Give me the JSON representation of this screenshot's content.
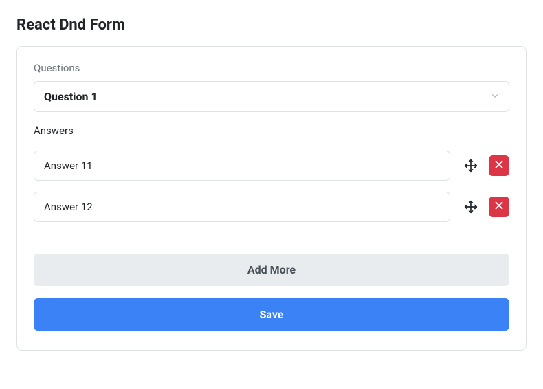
{
  "title": "React Dnd Form",
  "questions": {
    "label": "Questions",
    "selected": "Question 1"
  },
  "answers": {
    "label": "Answers",
    "items": [
      {
        "value": "Answer 11"
      },
      {
        "value": "Answer 12"
      }
    ]
  },
  "buttons": {
    "add_more": "Add More",
    "save": "Save"
  },
  "colors": {
    "primary": "#3b82f6",
    "danger": "#dc3545",
    "border": "#dee2e6",
    "muted": "#6c757d",
    "secondary_bg": "#e9ecef"
  }
}
